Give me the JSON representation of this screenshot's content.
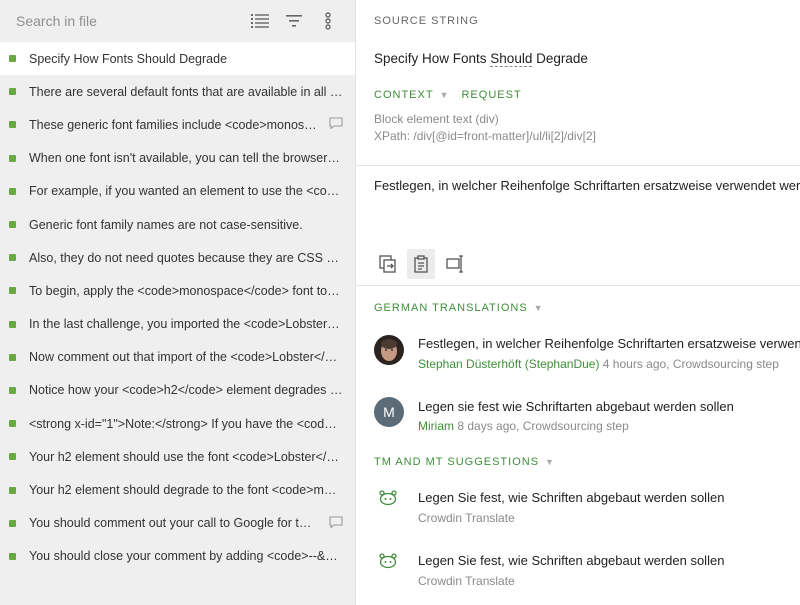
{
  "search": {
    "placeholder": "Search in file"
  },
  "toolbar_icons": [
    "list-icon",
    "filter-icon",
    "more-vertical-icon"
  ],
  "strings": [
    {
      "text": "Specify How Fonts Should Degrade",
      "active": true,
      "comment": false
    },
    {
      "text": "There are several default fonts that are available in all bro...",
      "active": false,
      "comment": false
    },
    {
      "text": "These generic font families include <code>monospac...",
      "active": false,
      "comment": true
    },
    {
      "text": "When one font isn't available, you can tell the browser to \"...",
      "active": false,
      "comment": false
    },
    {
      "text": "For example, if you wanted an element to use the <code>...",
      "active": false,
      "comment": false
    },
    {
      "text": "Generic font family names are not case-sensitive.",
      "active": false,
      "comment": false
    },
    {
      "text": "Also, they do not need quotes because they are CSS keyw...",
      "active": false,
      "comment": false
    },
    {
      "text": "To begin, apply the <code>monospace</code> font to the...",
      "active": false,
      "comment": false
    },
    {
      "text": "In the last challenge, you imported the <code>Lobster</co...",
      "active": false,
      "comment": false
    },
    {
      "text": "Now comment out that import of the <code>Lobster</cod...",
      "active": false,
      "comment": false
    },
    {
      "text": "Notice how your <code>h2</code> element degrades to t...",
      "active": false,
      "comment": false
    },
    {
      "text": "<strong x-id=\"1\">Note:</strong> If you have the <code>Lo...",
      "active": false,
      "comment": false
    },
    {
      "text": "Your h2 element should use the font <code>Lobster</cod...",
      "active": false,
      "comment": false
    },
    {
      "text": "Your h2 element should degrade to the font <code>mono...",
      "active": false,
      "comment": false
    },
    {
      "text": "You should comment out your call to Google for the <...",
      "active": false,
      "comment": true
    },
    {
      "text": "You should close your comment by adding <code>--&gt;</...",
      "active": false,
      "comment": false
    }
  ],
  "source": {
    "label": "SOURCE STRING",
    "text_before": "Specify How Fonts ",
    "text_dotted": "Should",
    "text_after": " Degrade"
  },
  "context": {
    "context_label": "CONTEXT",
    "request_label": "REQUEST",
    "line1": "Block element text (div)",
    "line2": "XPath: /div[@id=front-matter]/ul/li[2]/div[2]"
  },
  "editor": {
    "text": "Festlegen, in welcher Reihenfolge Schriftarten ersatzweise verwendet werden",
    "tools": [
      "copy-source-icon",
      "clipboard-icon",
      "text-cursor-icon"
    ]
  },
  "german_translations": {
    "label": "GERMAN TRANSLATIONS",
    "items": [
      {
        "text": "Festlegen, in welcher Reihenfolge Schriftarten ersatzweise verwendet werden",
        "author": "Stephan Düsterhöft (StephanDue)",
        "meta": " 4 hours ago, Crowdsourcing step",
        "avatar": "photo"
      },
      {
        "text": "Legen sie fest wie Schriftarten abgebaut werden sollen",
        "author": "Miriam",
        "meta": " 8 days ago, Crowdsourcing step",
        "avatar": "M"
      }
    ]
  },
  "suggestions": {
    "label": "TM AND MT SUGGESTIONS",
    "items": [
      {
        "text": "Legen Sie fest, wie Schriften abgebaut werden sollen",
        "source": "Crowdin Translate"
      },
      {
        "text": "Legen Sie fest, wie Schriften abgebaut werden sollen",
        "source": "Crowdin Translate"
      }
    ]
  },
  "colors": {
    "accent": "#3f8e3a",
    "dot": "#6aa843",
    "sidebar_bg": "#efefef"
  }
}
